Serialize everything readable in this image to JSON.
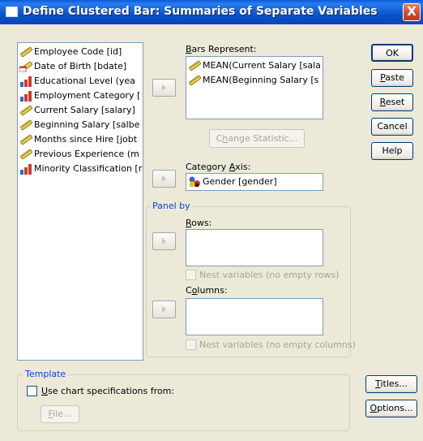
{
  "window": {
    "title": "Define Clustered Bar: Summaries of Separate Variables",
    "close_glyph": "X"
  },
  "variables": [
    {
      "label": "Employee Code [id]",
      "icon": "scale-ruler-icon"
    },
    {
      "label": "Date of Birth [bdate]",
      "icon": "date-scale-icon"
    },
    {
      "label": "Educational Level (yea",
      "icon": "ordinal-bar-icon"
    },
    {
      "label": "Employment Category [",
      "icon": "ordinal-bar-icon"
    },
    {
      "label": "Current Salary [salary]",
      "icon": "scale-ruler-icon"
    },
    {
      "label": "Beginning Salary [salbe",
      "icon": "scale-ruler-icon"
    },
    {
      "label": "Months since Hire [jobt",
      "icon": "scale-ruler-icon"
    },
    {
      "label": "Previous Experience (m",
      "icon": "scale-ruler-icon"
    },
    {
      "label": "Minority Classification [r",
      "icon": "ordinal-bar-icon"
    }
  ],
  "bars_represent": {
    "label_prefix": "",
    "label_u": "B",
    "label_rest": "ars Represent:",
    "items": [
      {
        "label": "MEAN(Current Salary [sala",
        "icon": "scale-ruler-icon"
      },
      {
        "label": "MEAN(Beginning Salary [s",
        "icon": "scale-ruler-icon"
      }
    ]
  },
  "change_statistic": {
    "pre": "C",
    "u": "h",
    "post": "ange Statistic..."
  },
  "category_axis": {
    "label_pre": "Category ",
    "label_u": "A",
    "label_post": "xis:",
    "value": "Gender [gender]",
    "icon": "nominal-gender-icon"
  },
  "panel_by": {
    "legend": "Panel by",
    "rows_u": "R",
    "rows_rest": "ows:",
    "nest_rows": "Nest variables (no empty rows)",
    "columns_pre": "C",
    "columns_u": "o",
    "columns_rest": "lumns:",
    "nest_columns": "Nest variables (no empty columns)"
  },
  "template": {
    "legend": "Template",
    "use_u": "U",
    "use_rest": "se chart specifications from:",
    "file_u": "F",
    "file_rest": "ile..."
  },
  "buttons": {
    "ok": "OK",
    "paste_u": "P",
    "paste_rest": "aste",
    "reset_u": "R",
    "reset_rest": "eset",
    "cancel": "Cancel",
    "help": "Help",
    "titles_u": "T",
    "titles_rest": "itles...",
    "options_u": "O",
    "options_rest": "ptions..."
  },
  "colors": {
    "accent": "#0046d5",
    "titlebar": "#0a52c8",
    "face": "#ECE9D8"
  }
}
